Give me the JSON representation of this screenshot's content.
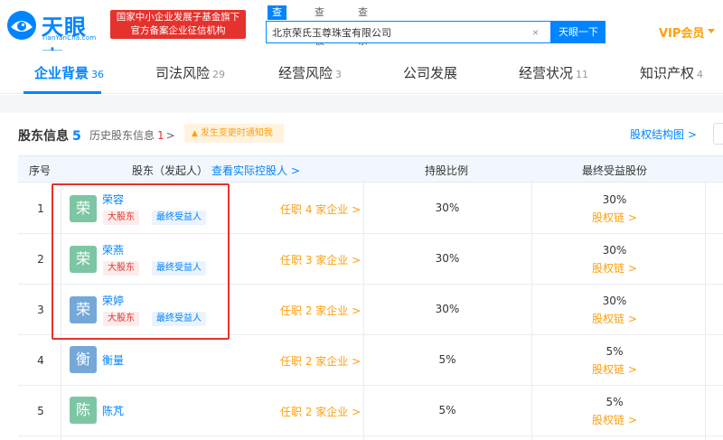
{
  "header": {
    "logo_text": "天眼查",
    "logo_sub": "TianYanCha.com",
    "gov_badge_line1": "国家中小企业发展子基金旗下",
    "gov_badge_line2": "官方备案企业征信机构",
    "search_tabs": [
      "查公司",
      "查老板",
      "查关系"
    ],
    "search_value": "北京荣氏玉尊珠宝有限公司",
    "search_button": "天眼一下",
    "vip_label": "VIP会员"
  },
  "nav": {
    "tabs": [
      {
        "label": "企业背景",
        "count": "36"
      },
      {
        "label": "司法风险",
        "count": "29"
      },
      {
        "label": "经营风险",
        "count": "3"
      },
      {
        "label": "公司发展",
        "count": ""
      },
      {
        "label": "经营状况",
        "count": "11"
      },
      {
        "label": "知识产权",
        "count": "4"
      }
    ]
  },
  "section": {
    "title": "股东信息",
    "count": "5",
    "history_label": "历史股东信息",
    "history_count": "1",
    "notify_label": "发生变更时通知我",
    "equity_link": "股权结构图"
  },
  "table": {
    "headers": {
      "idx": "序号",
      "holder": "股东（发起人）",
      "holder_link": "查看实际控股人",
      "ratio": "持股比例",
      "final": "最终受益股份"
    },
    "rows": [
      {
        "idx": "1",
        "avatar": "荣",
        "name": "荣容",
        "tags": [
          "大股东",
          "最终受益人"
        ],
        "posts": "任职 4 家企业",
        "ratio": "30%",
        "final": "30%",
        "chain": "股权链"
      },
      {
        "idx": "2",
        "avatar": "荣",
        "name": "荣燕",
        "tags": [
          "大股东",
          "最终受益人"
        ],
        "posts": "任职 3 家企业",
        "ratio": "30%",
        "final": "30%",
        "chain": "股权链"
      },
      {
        "idx": "3",
        "avatar": "荣",
        "name": "荣婷",
        "tags": [
          "大股东",
          "最终受益人"
        ],
        "posts": "任职 2 家企业",
        "ratio": "30%",
        "final": "30%",
        "chain": "股权链"
      },
      {
        "idx": "4",
        "avatar": "衡",
        "name": "衡量",
        "tags": [],
        "posts": "任职 2 家企业",
        "ratio": "5%",
        "final": "5%",
        "chain": "股权链"
      },
      {
        "idx": "5",
        "avatar": "陈",
        "name": "陈芃",
        "tags": [],
        "posts": "任职 2 家企业",
        "ratio": "5%",
        "final": "5%",
        "chain": "股权链"
      }
    ]
  },
  "colors": {
    "brand_blue": "#0084ff",
    "accent_orange": "#ff9f0a",
    "alert_red": "#e5322d",
    "avatar_green": "#7dc6a4",
    "avatar_blue": "#74a8d8"
  }
}
